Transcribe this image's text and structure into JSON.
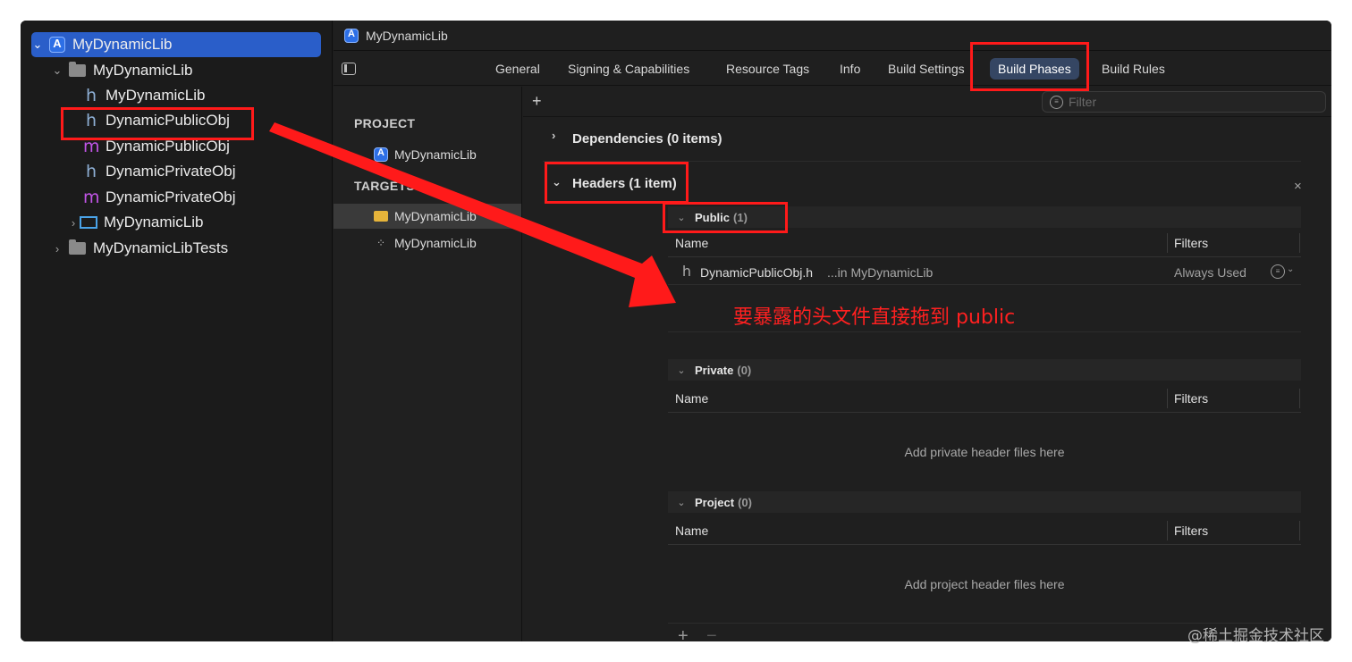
{
  "navigator": {
    "items": [
      {
        "label": "MyDynamicLib",
        "kind": "project",
        "icon": "app-project-icon",
        "selected": true
      },
      {
        "label": "MyDynamicLib",
        "kind": "group",
        "icon": "folder-icon"
      },
      {
        "label": "MyDynamicLib",
        "kind": "header",
        "icon": "h-file-icon"
      },
      {
        "label": "DynamicPublicObj",
        "kind": "header",
        "icon": "h-file-icon"
      },
      {
        "label": "DynamicPublicObj",
        "kind": "implementation",
        "icon": "m-file-icon"
      },
      {
        "label": "DynamicPrivateObj",
        "kind": "header",
        "icon": "h-file-icon"
      },
      {
        "label": "DynamicPrivateObj",
        "kind": "implementation",
        "icon": "m-file-icon"
      },
      {
        "label": "MyDynamicLib",
        "kind": "products",
        "icon": "library-icon"
      },
      {
        "label": "MyDynamicLibTests",
        "kind": "group",
        "icon": "folder-icon"
      }
    ]
  },
  "editor": {
    "title": "MyDynamicLib",
    "tabs": [
      "General",
      "Signing & Capabilities",
      "Resource Tags",
      "Info",
      "Build Settings",
      "Build Phases",
      "Build Rules"
    ],
    "active_tab": "Build Phases"
  },
  "project_list": {
    "project_header": "PROJECT",
    "project_item": "MyDynamicLib",
    "targets_header": "TARGETS",
    "targets": [
      "MyDynamicLib",
      "MyDynamicLib"
    ]
  },
  "phases": {
    "filter_placeholder": "Filter",
    "add_symbol": "+",
    "dependencies": "Dependencies (0 items)",
    "headers": "Headers (1 item)",
    "close_symbol": "×",
    "public": {
      "label": "Public",
      "count": "(1)"
    },
    "private": {
      "label": "Private",
      "count": "(0)"
    },
    "project": {
      "label": "Project",
      "count": "(0)"
    },
    "col_name": "Name",
    "col_filters": "Filters",
    "public_file": {
      "name": "DynamicPublicObj.h",
      "location": "...in MyDynamicLib",
      "filter": "Always Used"
    },
    "private_empty": "Add private header files here",
    "project_empty": "Add project header files here",
    "bottom_add": "+",
    "bottom_remove": "−"
  },
  "annotation": {
    "note": "要暴露的头文件直接拖到 public",
    "color": "#ff1a1a"
  },
  "watermark": "@稀土掘金技术社区",
  "colors": {
    "selection": "#2a5ec9",
    "active_tab": "#354663",
    "background": "#1e1e1e"
  }
}
